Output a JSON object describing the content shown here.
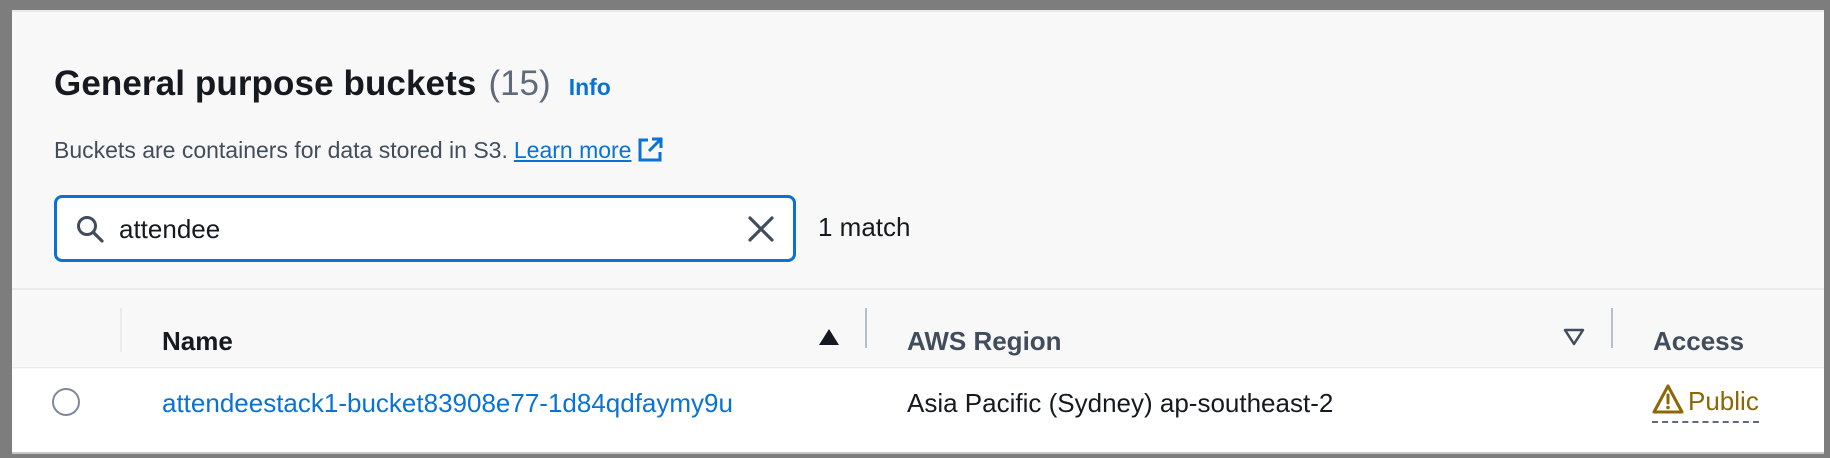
{
  "header": {
    "title": "General purpose buckets",
    "count": "(15)",
    "info_label": "Info"
  },
  "description": {
    "text": "Buckets are containers for data stored in S3.",
    "learn_more": "Learn more"
  },
  "search": {
    "value": "attendee",
    "match_text": "1 match"
  },
  "table": {
    "columns": [
      "Name",
      "AWS Region",
      "Access"
    ],
    "rows": [
      {
        "name": "attendeestack1-bucket83908e77-1d84qdfaymy9u",
        "region": "Asia Pacific (Sydney) ap-southeast-2",
        "access": "Public"
      }
    ]
  },
  "colors": {
    "link": "#0972d3",
    "warning": "#8d6605",
    "focus_border": "#0972d3"
  },
  "icons": {
    "search": "search-icon",
    "clear": "close-icon",
    "external": "external-link-icon",
    "sort_asc": "sort-ascending-icon",
    "sort_none": "sort-descending-outline-icon",
    "warning": "warning-icon"
  }
}
